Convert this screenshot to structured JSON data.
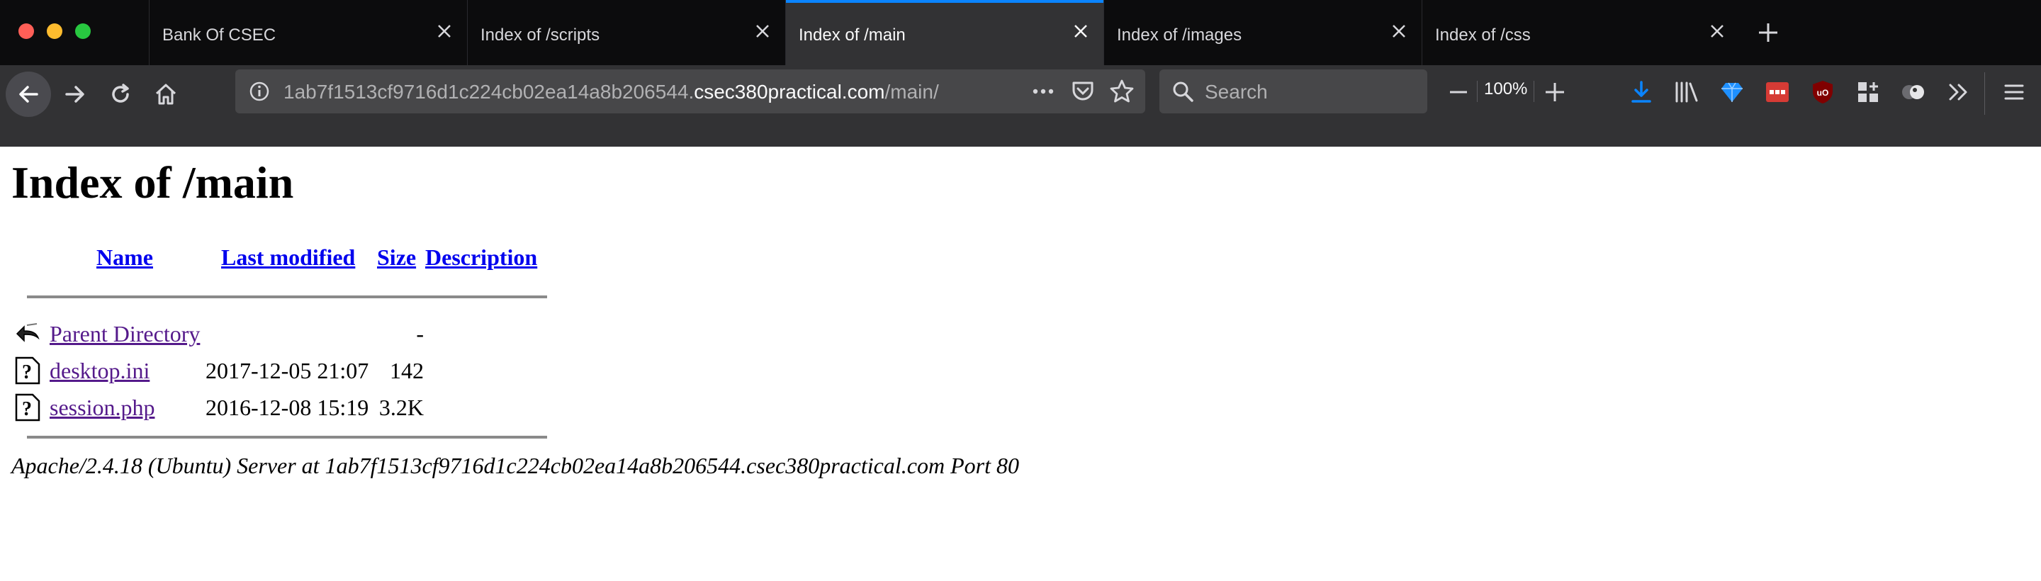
{
  "browser": {
    "tabs": [
      {
        "label": "Bank Of CSEC",
        "active": false
      },
      {
        "label": "Index of /scripts",
        "active": false
      },
      {
        "label": "Index of /main",
        "active": true
      },
      {
        "label": "Index of /images",
        "active": false
      },
      {
        "label": "Index of /css",
        "active": false
      }
    ],
    "url": {
      "prefix": "1ab7f1513cf9716d1c224cb02ea14a8b206544.",
      "host": "csec380practical.com",
      "path": "/main/"
    },
    "search_placeholder": "Search",
    "zoom_level": "100%",
    "colors": {
      "accent": "#0a84ff",
      "toolbar": "#323234",
      "tabstrip": "#0c0c0d"
    }
  },
  "page": {
    "title": "Index of /main",
    "columns": {
      "name": "Name",
      "last_modified": "Last modified",
      "size": "Size",
      "description": "Description"
    },
    "rows": [
      {
        "icon": "back-arrow-icon",
        "name": "Parent Directory",
        "modified": "",
        "size": "-",
        "description": ""
      },
      {
        "icon": "unknown-file-icon",
        "name": "desktop.ini",
        "modified": "2017-12-05 21:07",
        "size": "142",
        "description": ""
      },
      {
        "icon": "unknown-file-icon",
        "name": "session.php",
        "modified": "2016-12-08 15:19",
        "size": "3.2K",
        "description": ""
      }
    ],
    "address": "Apache/2.4.18 (Ubuntu) Server at 1ab7f1513cf9716d1c224cb02ea14a8b206544.csec380practical.com Port 80",
    "colors": {
      "link": "#0000ee",
      "visited": "#551a8b"
    }
  }
}
